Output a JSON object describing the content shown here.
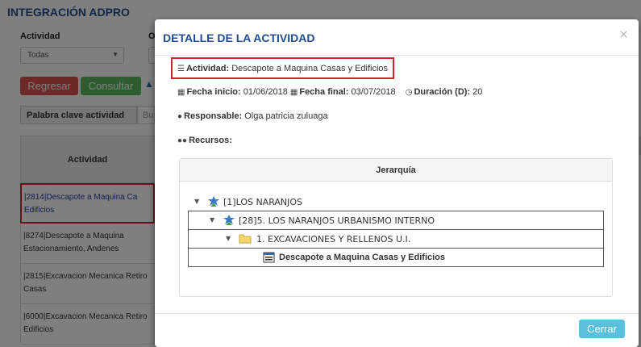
{
  "background": {
    "page_title": "INTEGRACIÓN ADPRO",
    "activity_label": "Actividad",
    "second_label": "O",
    "activity_select_value": "Todas",
    "back_button": "Regresar",
    "query_button": "Consultar",
    "keyword_label": "Palabra clave actividad",
    "keyword_input_partial": "Bu",
    "table_header": "Actividad",
    "rows": [
      "|2814|Descapote a Maquina Ca Edificios",
      "|8274|Descapote a Maquina Estacionamiento, Andenes",
      "|2815|Excavacion Mecanica Retiro Casas",
      "|6000|Excavacion Mecanica Retiro Edificios"
    ]
  },
  "modal": {
    "title": "DETALLE DE LA ACTIVIDAD",
    "activity_label": "Actividad:",
    "activity_value": "Descapote a Maquina Casas y Edificios",
    "start_label": "Fecha inicio:",
    "start_value": "01/06/2018",
    "end_label": "Fecha final:",
    "end_value": "03/07/2018",
    "duration_label": "Duración (D):",
    "duration_value": "20",
    "responsible_label": "Responsable:",
    "responsible_value": "Olga patricia zuluaga",
    "resources_label": "Recursos:",
    "hierarchy_title": "Jerarquía",
    "tree": [
      {
        "label": "[1]LOS NARANJOS",
        "icon": "project-icon"
      },
      {
        "label": "[28]5. LOS NARANJOS URBANISMO INTERNO",
        "icon": "project-icon"
      },
      {
        "label": "1. EXCAVACIONES Y RELLENOS U.I.",
        "icon": "folder-icon"
      },
      {
        "label": "Descapote a Maquina Casas y Edificios",
        "icon": "task-icon"
      }
    ],
    "close_button": "Cerrar"
  },
  "colors": {
    "title": "#1f4e8c",
    "highlight": "#d9212f",
    "regresar": "#d9534f",
    "consultar": "#5cb85c",
    "cerrar": "#5bc0de"
  }
}
